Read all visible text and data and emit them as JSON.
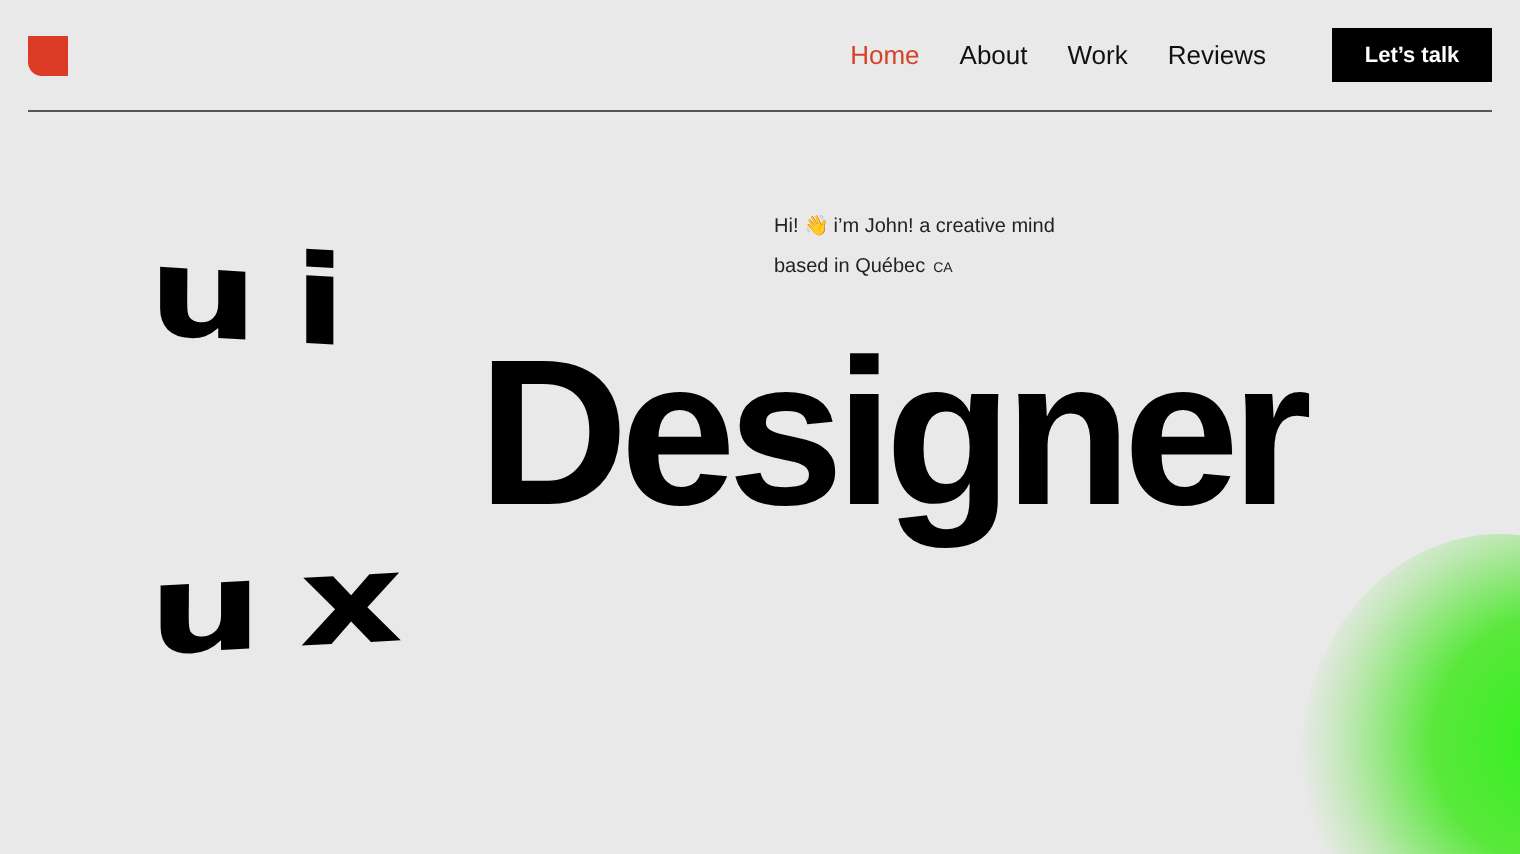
{
  "nav": {
    "links": [
      {
        "label": "Home",
        "selected": true
      },
      {
        "label": "About",
        "selected": false
      },
      {
        "label": "Work",
        "selected": false
      },
      {
        "label": "Reviews",
        "selected": false
      }
    ],
    "cta": "Let’s talk"
  },
  "hero": {
    "intro": "Hi! 👋 i’m John! a creative mind",
    "location": "based in Québec",
    "country": "CA",
    "top_word": "ui",
    "bottom_word": "ux",
    "headline": "Designer"
  }
}
